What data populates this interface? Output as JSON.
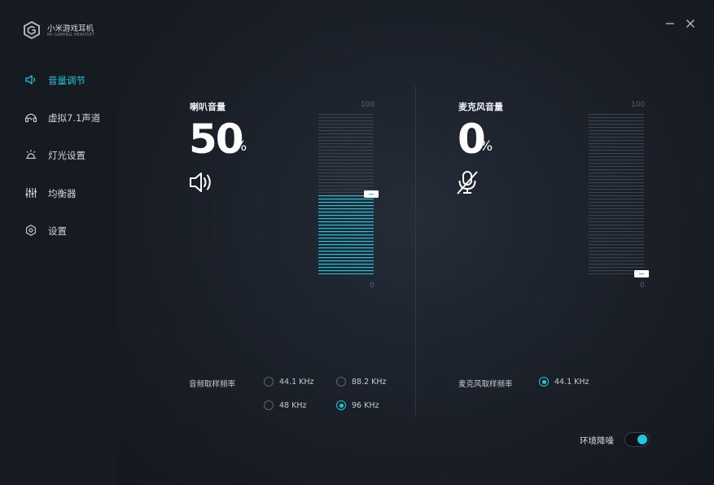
{
  "app": {
    "title": "小米游戏耳机",
    "subtitle": "MI GAMING HEADSET"
  },
  "colors": {
    "accent": "#20c6da",
    "sidebar_bg": "#161b22",
    "main_bg": "#1a1f28"
  },
  "window": {
    "minimize_icon": "minimize-icon",
    "close_icon": "close-icon"
  },
  "sidebar": {
    "items": [
      {
        "label": "音量调节",
        "icon": "speaker-icon",
        "active": true
      },
      {
        "label": "虚拟7.1声道",
        "icon": "headset-icon",
        "active": false
      },
      {
        "label": "灯光设置",
        "icon": "light-icon",
        "active": false
      },
      {
        "label": "均衡器",
        "icon": "equalizer-icon",
        "active": false
      },
      {
        "label": "设置",
        "icon": "settings-icon",
        "active": false
      }
    ]
  },
  "speaker": {
    "title": "喇叭音量",
    "value": "50",
    "unit": "%",
    "level": 0.5,
    "scale_max": "100",
    "scale_min": "0",
    "icon": "speaker-volume-icon"
  },
  "mic": {
    "title": "麦克风音量",
    "value": "0",
    "unit": "%",
    "level": 0.0,
    "scale_max": "100",
    "scale_min": "0",
    "icon": "mic-muted-icon"
  },
  "audio_sample_rate": {
    "label": "音频取样频率",
    "options": [
      {
        "label": "44.1 KHz",
        "checked": false
      },
      {
        "label": "88.2 KHz",
        "checked": false
      },
      {
        "label": "48 KHz",
        "checked": false
      },
      {
        "label": "96 KHz",
        "checked": true
      }
    ]
  },
  "mic_sample_rate": {
    "label": "麦克风取样频率",
    "options": [
      {
        "label": "44.1 KHz",
        "checked": true
      }
    ]
  },
  "noise_reduction": {
    "label": "环境降噪",
    "on": true
  }
}
